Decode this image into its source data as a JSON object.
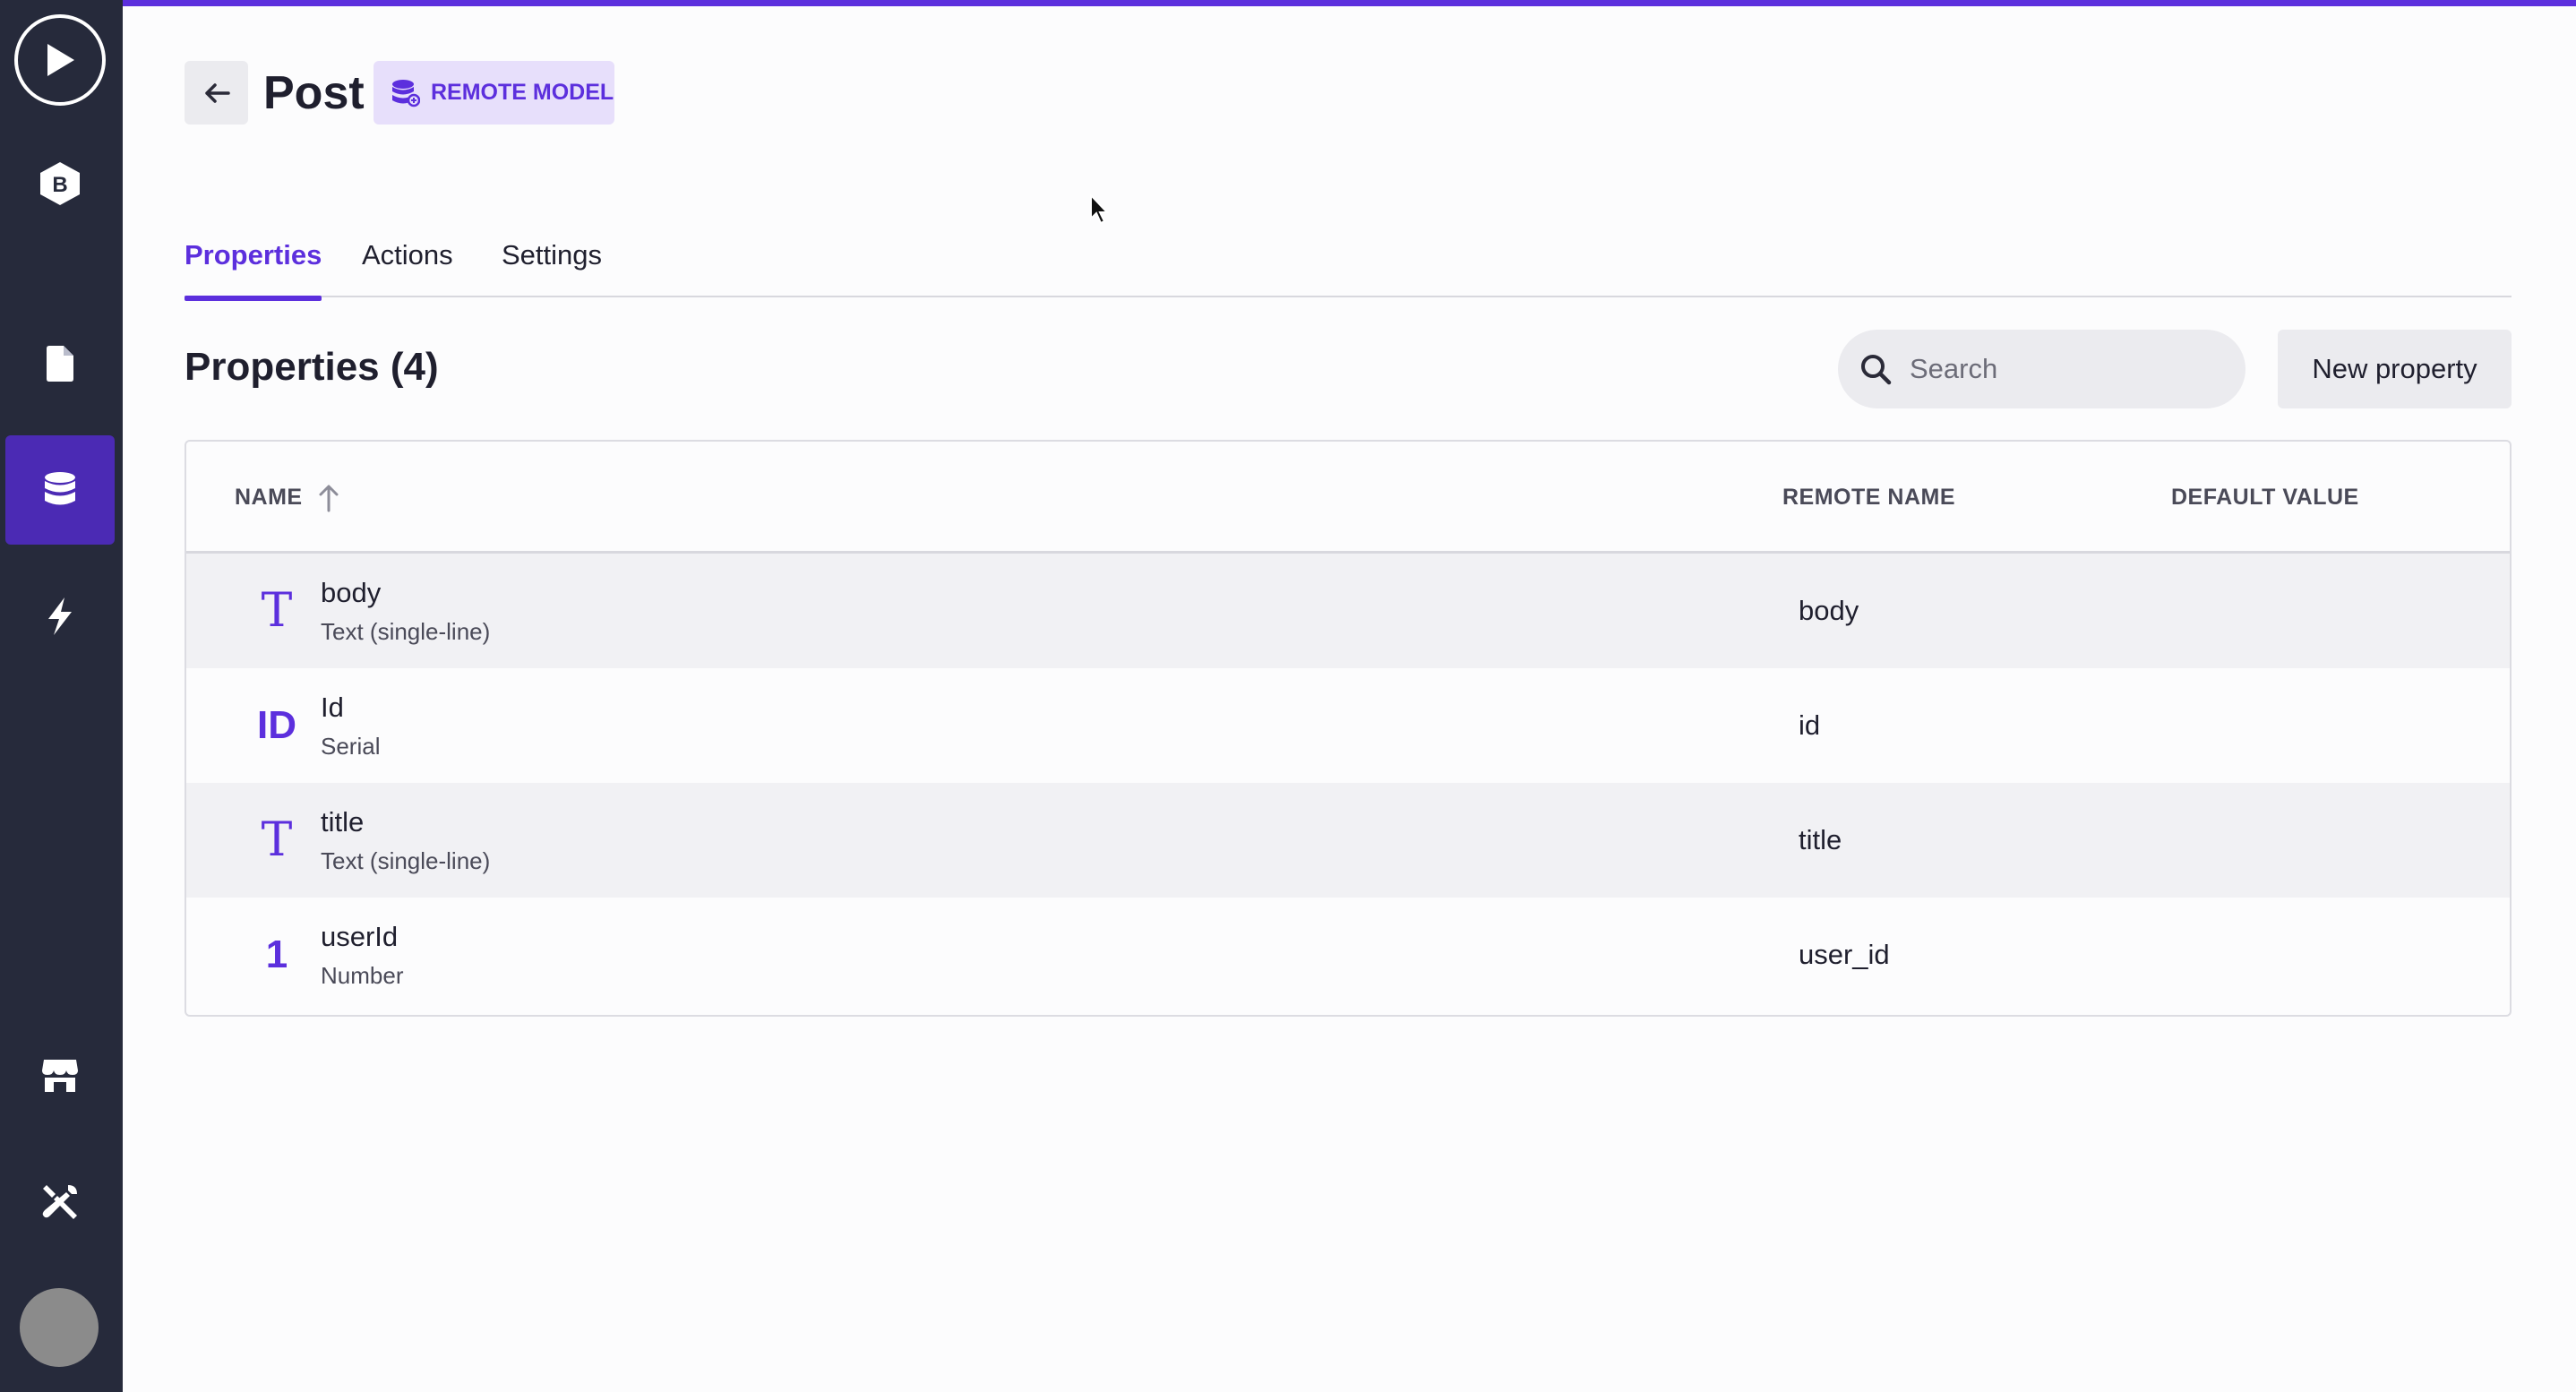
{
  "sidebar": {
    "items": [
      {
        "name": "play",
        "icon": "play-icon"
      },
      {
        "name": "logo",
        "icon": "logo-icon",
        "letter": "B"
      },
      {
        "name": "pages",
        "icon": "file-icon"
      },
      {
        "name": "models",
        "icon": "database-icon",
        "active": true
      },
      {
        "name": "actions",
        "icon": "bolt-icon"
      },
      {
        "name": "store",
        "icon": "store-icon"
      },
      {
        "name": "tools",
        "icon": "tools-icon"
      },
      {
        "name": "avatar",
        "icon": "avatar"
      }
    ]
  },
  "header": {
    "title": "Post",
    "badge_label": "REMOTE MODEL",
    "badge_icon": "remote-database-icon"
  },
  "tabs": [
    {
      "label": "Properties",
      "active": true
    },
    {
      "label": "Actions",
      "active": false
    },
    {
      "label": "Settings",
      "active": false
    }
  ],
  "section": {
    "title": "Properties (4)",
    "search_placeholder": "Search",
    "new_button_label": "New property"
  },
  "table": {
    "columns": [
      "NAME",
      "REMOTE NAME",
      "DEFAULT VALUE"
    ],
    "sort_column": "NAME",
    "sort_direction": "ascending",
    "rows": [
      {
        "icon": "T",
        "icon_name": "text-type-icon",
        "name": "body",
        "type": "Text (single-line)",
        "remote_name": "body",
        "default_value": ""
      },
      {
        "icon": "ID",
        "icon_name": "id-type-icon",
        "name": "Id",
        "type": "Serial",
        "remote_name": "id",
        "default_value": ""
      },
      {
        "icon": "T",
        "icon_name": "text-type-icon",
        "name": "title",
        "type": "Text (single-line)",
        "remote_name": "title",
        "default_value": ""
      },
      {
        "icon": "1",
        "icon_name": "number-type-icon",
        "name": "userId",
        "type": "Number",
        "remote_name": "user_id",
        "default_value": ""
      }
    ]
  },
  "colors": {
    "accent": "#5c2fdd",
    "sidebar_bg": "#262a3b",
    "sidebar_active": "#4b2ab4",
    "badge_bg": "#e7dffb"
  }
}
